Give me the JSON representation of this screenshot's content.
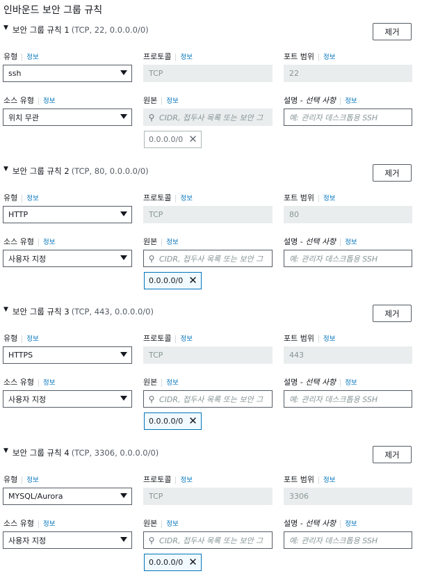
{
  "title": "인바운드 보안 그룹 규칙",
  "labels": {
    "type": "유형",
    "info": "정보",
    "protocol": "프로토콜",
    "port_range": "포트 범위",
    "source_type": "소스 유형",
    "source": "원본",
    "description": "설명 - ",
    "description_optional": "선택 사항",
    "remove": "제거",
    "source_placeholder": "CIDR, 접두사 목록 또는 보안 그",
    "description_placeholder": "예: 관리자 데스크톱용 SSH"
  },
  "rules": [
    {
      "name": "보안 그룹 규칙 1",
      "detail": "(TCP, 22, 0.0.0.0/0)",
      "type": "ssh",
      "protocol": "TCP",
      "port": "22",
      "source_type": "위치 무관",
      "cidr": "0.0.0.0/0"
    },
    {
      "name": "보안 그룹 규칙 2",
      "detail": "(TCP, 80, 0.0.0.0/0)",
      "type": "HTTP",
      "protocol": "TCP",
      "port": "80",
      "source_type": "사용자 지정",
      "cidr": "0.0.0.0/0"
    },
    {
      "name": "보안 그룹 규칙 3",
      "detail": "(TCP, 443, 0.0.0.0/0)",
      "type": "HTTPS",
      "protocol": "TCP",
      "port": "443",
      "source_type": "사용자 지정",
      "cidr": "0.0.0.0/0"
    },
    {
      "name": "보안 그룹 규칙 4",
      "detail": "(TCP, 3306, 0.0.0.0/0)",
      "type": "MYSQL/Aurora",
      "protocol": "TCP",
      "port": "3306",
      "source_type": "사용자 지정",
      "cidr": "0.0.0.0/0"
    }
  ]
}
